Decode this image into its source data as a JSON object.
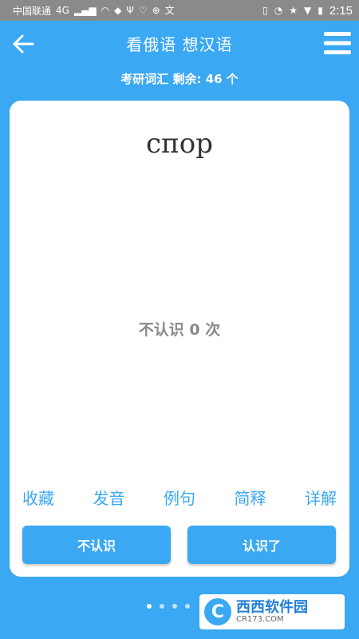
{
  "status_bar": {
    "carrier": "中国联通",
    "network": "4G",
    "time": "2:15"
  },
  "header": {
    "title": "看俄语 想汉语",
    "subtitle": "考研词汇 剩余: 46 个"
  },
  "card": {
    "word": "спор",
    "unknown_count_text": "不认识 0 次",
    "actions": [
      "收藏",
      "发音",
      "例句",
      "简释",
      "详解"
    ],
    "btn_unknown": "不认识",
    "btn_known": "认识了"
  },
  "pager": {
    "total_visible": 4,
    "active_index": 0
  },
  "watermark": {
    "logo_letter": "C",
    "title": "西西软件园",
    "sub": "CR173.COM"
  },
  "colors": {
    "primary": "#3aa8f2",
    "card": "#ffffff",
    "muted_text": "#8a8a8a"
  },
  "icons": {
    "back": "arrow-left-icon",
    "menu": "hamburger-menu-icon"
  }
}
